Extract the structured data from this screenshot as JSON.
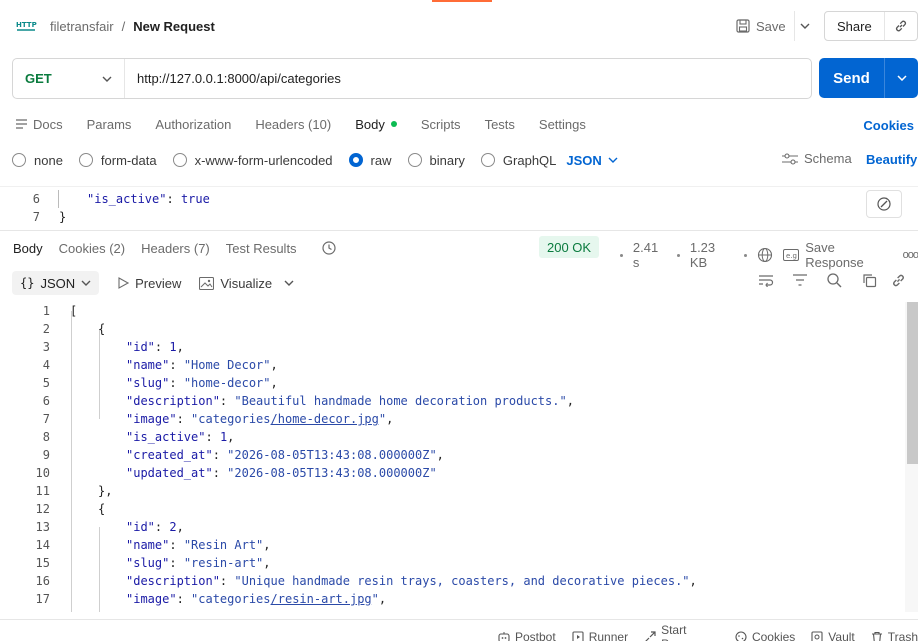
{
  "header": {
    "workspace": "filetransfair",
    "separator": "/",
    "request_name": "New Request",
    "save_label": "Save",
    "share_label": "Share"
  },
  "request": {
    "method": "GET",
    "url": "http://127.0.0.1:8000/api/categories",
    "send_label": "Send"
  },
  "request_tabs": [
    {
      "label": "Docs"
    },
    {
      "label": "Params"
    },
    {
      "label": "Authorization"
    },
    {
      "label": "Headers (10)"
    },
    {
      "label": "Body"
    },
    {
      "label": "Scripts"
    },
    {
      "label": "Tests"
    },
    {
      "label": "Settings"
    }
  ],
  "cookies_link": "Cookies",
  "body_modes": [
    {
      "label": "none",
      "selected": false
    },
    {
      "label": "form-data",
      "selected": false
    },
    {
      "label": "x-www-form-urlencoded",
      "selected": false
    },
    {
      "label": "raw",
      "selected": true
    },
    {
      "label": "binary",
      "selected": false
    },
    {
      "label": "GraphQL",
      "selected": false
    }
  ],
  "body_format": "JSON",
  "schema_label": "Schema",
  "beautify_label": "Beautify",
  "request_body_lines": [
    {
      "n": "6",
      "text": "\"is_active\": true"
    },
    {
      "n": "7",
      "text": "}"
    }
  ],
  "response_tabs": [
    {
      "label": "Body"
    },
    {
      "label": "Cookies (2)"
    },
    {
      "label": "Headers (7)"
    },
    {
      "label": "Test Results"
    }
  ],
  "response_meta": {
    "status": "200 OK",
    "time": "2.41 s",
    "size": "1.23 KB",
    "save_response": "Save Response",
    "more": "ooo"
  },
  "response_toolbar": {
    "format_symbol": "{}",
    "format": "JSON",
    "preview": "Preview",
    "visualize": "Visualize"
  },
  "response_lines": [
    {
      "n": "1",
      "indent": 0,
      "parts": [
        [
          "p",
          "["
        ]
      ]
    },
    {
      "n": "2",
      "indent": 1,
      "parts": [
        [
          "p",
          "{"
        ]
      ]
    },
    {
      "n": "3",
      "indent": 2,
      "parts": [
        [
          "k",
          "\"id\""
        ],
        [
          "p",
          ": "
        ],
        [
          "n",
          "1"
        ],
        [
          "p",
          ","
        ]
      ]
    },
    {
      "n": "4",
      "indent": 2,
      "parts": [
        [
          "k",
          "\"name\""
        ],
        [
          "p",
          ": "
        ],
        [
          "s",
          "\"Home Decor\""
        ],
        [
          "p",
          ","
        ]
      ]
    },
    {
      "n": "5",
      "indent": 2,
      "parts": [
        [
          "k",
          "\"slug\""
        ],
        [
          "p",
          ": "
        ],
        [
          "s",
          "\"home-decor\""
        ],
        [
          "p",
          ","
        ]
      ]
    },
    {
      "n": "6",
      "indent": 2,
      "parts": [
        [
          "k",
          "\"description\""
        ],
        [
          "p",
          ": "
        ],
        [
          "s",
          "\"Beautiful handmade home decoration products.\""
        ],
        [
          "p",
          ","
        ]
      ]
    },
    {
      "n": "7",
      "indent": 2,
      "parts": [
        [
          "k",
          "\"image\""
        ],
        [
          "p",
          ": "
        ],
        [
          "s",
          "\"categories"
        ],
        [
          "u",
          "/home-decor.jpg"
        ],
        [
          "s",
          "\""
        ],
        [
          "p",
          ","
        ]
      ]
    },
    {
      "n": "8",
      "indent": 2,
      "parts": [
        [
          "k",
          "\"is_active\""
        ],
        [
          "p",
          ": "
        ],
        [
          "n",
          "1"
        ],
        [
          "p",
          ","
        ]
      ]
    },
    {
      "n": "9",
      "indent": 2,
      "parts": [
        [
          "k",
          "\"created_at\""
        ],
        [
          "p",
          ": "
        ],
        [
          "s",
          "\"2026-08-05T13:43:08.000000Z\""
        ],
        [
          "p",
          ","
        ]
      ]
    },
    {
      "n": "10",
      "indent": 2,
      "parts": [
        [
          "k",
          "\"updated_at\""
        ],
        [
          "p",
          ": "
        ],
        [
          "s",
          "\"2026-08-05T13:43:08.000000Z\""
        ]
      ]
    },
    {
      "n": "11",
      "indent": 1,
      "parts": [
        [
          "p",
          "},"
        ]
      ]
    },
    {
      "n": "12",
      "indent": 1,
      "parts": [
        [
          "p",
          "{"
        ]
      ]
    },
    {
      "n": "13",
      "indent": 2,
      "parts": [
        [
          "k",
          "\"id\""
        ],
        [
          "p",
          ": "
        ],
        [
          "n",
          "2"
        ],
        [
          "p",
          ","
        ]
      ]
    },
    {
      "n": "14",
      "indent": 2,
      "parts": [
        [
          "k",
          "\"name\""
        ],
        [
          "p",
          ": "
        ],
        [
          "s",
          "\"Resin Art\""
        ],
        [
          "p",
          ","
        ]
      ]
    },
    {
      "n": "15",
      "indent": 2,
      "parts": [
        [
          "k",
          "\"slug\""
        ],
        [
          "p",
          ": "
        ],
        [
          "s",
          "\"resin-art\""
        ],
        [
          "p",
          ","
        ]
      ]
    },
    {
      "n": "16",
      "indent": 2,
      "parts": [
        [
          "k",
          "\"description\""
        ],
        [
          "p",
          ": "
        ],
        [
          "s",
          "\"Unique handmade resin trays, coasters, and decorative pieces.\""
        ],
        [
          "p",
          ","
        ]
      ]
    },
    {
      "n": "17",
      "indent": 2,
      "parts": [
        [
          "k",
          "\"image\""
        ],
        [
          "p",
          ": "
        ],
        [
          "s",
          "\"categories"
        ],
        [
          "u",
          "/resin-art.jpg"
        ],
        [
          "s",
          "\""
        ],
        [
          "p",
          ","
        ]
      ]
    }
  ],
  "status_bar": [
    {
      "label": "Postbot",
      "icon": "postbot-icon"
    },
    {
      "label": "Runner",
      "icon": "runner-icon"
    },
    {
      "label": "Start Proxy",
      "icon": "proxy-icon"
    },
    {
      "label": "Cookies",
      "icon": "cookie-icon"
    },
    {
      "label": "Vault",
      "icon": "vault-icon"
    },
    {
      "label": "Trash",
      "icon": "trash-icon"
    }
  ],
  "colors": {
    "send": "#0265d2",
    "accent_orange": "#ff6c37",
    "get_method": "#0a7b3e",
    "status_ok_bg": "#e6f7ee"
  }
}
